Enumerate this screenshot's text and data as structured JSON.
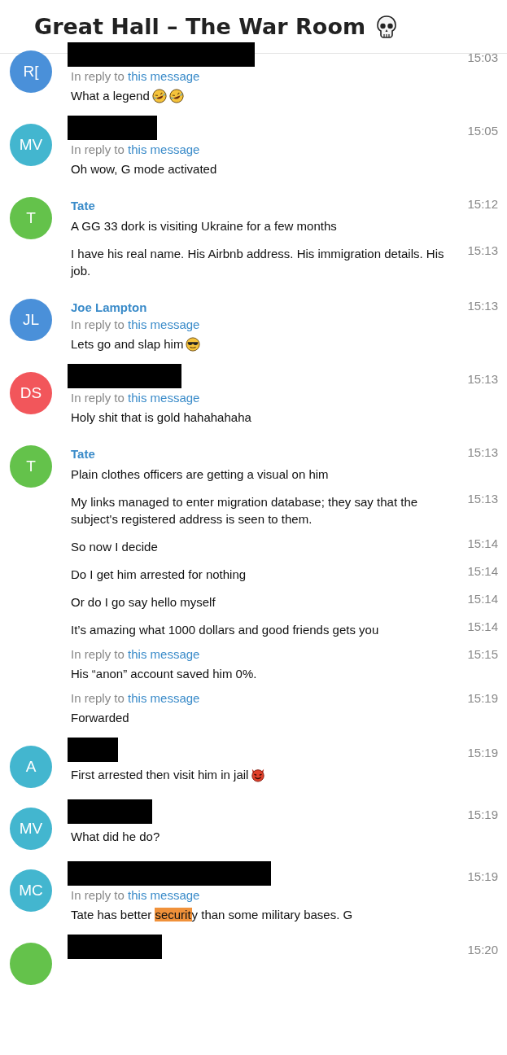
{
  "header": {
    "title": "Great Hall – The War Room"
  },
  "groups": [
    {
      "avatar": {
        "initials": "R[",
        "color": "#4a90d9"
      },
      "sender": {
        "kind": "redacted"
      },
      "messages": [
        {
          "reply": {
            "prefix": "In reply to",
            "link": "this message"
          },
          "text": [
            {
              "text": "What a legend"
            }
          ],
          "kind": "laughing",
          "time": "15:03"
        }
      ]
    },
    {
      "avatar": {
        "initials": "MV",
        "color": "#43b6cf"
      },
      "sender": {
        "kind": "redacted"
      },
      "messages": [
        {
          "reply": {
            "prefix": "In reply to",
            "link": "this message"
          },
          "text": [
            {
              "text": "Oh wow, G mode activated"
            }
          ],
          "time": "15:05"
        }
      ]
    },
    {
      "avatar": {
        "initials": "T",
        "color": "#64c24b"
      },
      "sender": {
        "kind": "name",
        "name": "Tate"
      },
      "messages": [
        {
          "text": [
            {
              "text": "A GG 33 dork is visiting Ukraine for a few months"
            }
          ],
          "time": "15:12"
        },
        {
          "text": [
            {
              "text": "I have his real name. His Airbnb address. His immigration details. His job."
            }
          ],
          "time": "15:13"
        }
      ]
    },
    {
      "avatar": {
        "initials": "JL",
        "color": "#4a90d9"
      },
      "sender": {
        "kind": "name",
        "name": "Joe Lampton"
      },
      "messages": [
        {
          "reply": {
            "prefix": "In reply to",
            "link": "this message"
          },
          "text": [
            {
              "text": "Lets go and slap him"
            }
          ],
          "kind": "cool",
          "time": "15:13"
        }
      ]
    },
    {
      "avatar": {
        "initials": "DS",
        "color": "#f2565b"
      },
      "sender": {
        "kind": "redacted"
      },
      "messages": [
        {
          "reply": {
            "prefix": "In reply to",
            "link": "this message"
          },
          "text": [
            {
              "text": "Holy shit that is gold hahahahaha"
            }
          ],
          "time": "15:13"
        }
      ]
    },
    {
      "avatar": {
        "initials": "T",
        "color": "#64c24b"
      },
      "sender": {
        "kind": "name",
        "name": "Tate"
      },
      "messages": [
        {
          "text": [
            {
              "text": "Plain clothes officers are getting a visual on him"
            }
          ],
          "time": "15:13"
        },
        {
          "text": [
            {
              "text": "My links managed to enter migration database; they say that the subject's registered address is seen to them."
            }
          ],
          "time": "15:13"
        },
        {
          "text": [
            {
              "text": "So now I decide"
            }
          ],
          "time": "15:14"
        },
        {
          "text": [
            {
              "text": "Do I get him arrested for nothing"
            }
          ],
          "time": "15:14"
        },
        {
          "text": [
            {
              "text": "Or do I go say hello myself"
            }
          ],
          "time": "15:14"
        },
        {
          "text": [
            {
              "text": "It’s amazing what 1000 dollars and good friends gets you"
            }
          ],
          "time": "15:14"
        },
        {
          "reply": {
            "prefix": "In reply to",
            "link": "this message"
          },
          "text": [
            {
              "text": "His “anon” account saved him 0%."
            }
          ],
          "time": "15:15"
        },
        {
          "reply": {
            "prefix": "In reply to",
            "link": "this message"
          },
          "text": [
            {
              "text": "Forwarded"
            }
          ],
          "time": "15:19"
        }
      ]
    },
    {
      "avatar": {
        "initials": "A",
        "color": "#43b6cf"
      },
      "sender": {
        "kind": "redacted"
      },
      "messages": [
        {
          "text": [
            {
              "text": "First arrested then visit him in jail"
            }
          ],
          "kind": "devil",
          "time": "15:19"
        }
      ]
    },
    {
      "avatar": {
        "initials": "MV",
        "color": "#43b6cf"
      },
      "sender": {
        "kind": "redacted"
      },
      "messages": [
        {
          "text": [
            {
              "text": "What did he do?"
            }
          ],
          "time": "15:19"
        }
      ]
    },
    {
      "avatar": {
        "initials": "MC",
        "color": "#43b6cf"
      },
      "sender": {
        "kind": "redacted"
      },
      "messages": [
        {
          "reply": {
            "prefix": "In reply to",
            "link": "this message"
          },
          "text": [
            {
              "text": "Tate has better "
            },
            {
              "text": "securit",
              "highlighted": true
            },
            {
              "text": "y than some military bases. G"
            }
          ],
          "time": "15:19"
        }
      ]
    },
    {
      "avatar": {
        "color": "#64c24b"
      },
      "sender": {
        "kind": "redacted"
      },
      "messages": [
        {
          "time": "15:20"
        }
      ]
    }
  ]
}
